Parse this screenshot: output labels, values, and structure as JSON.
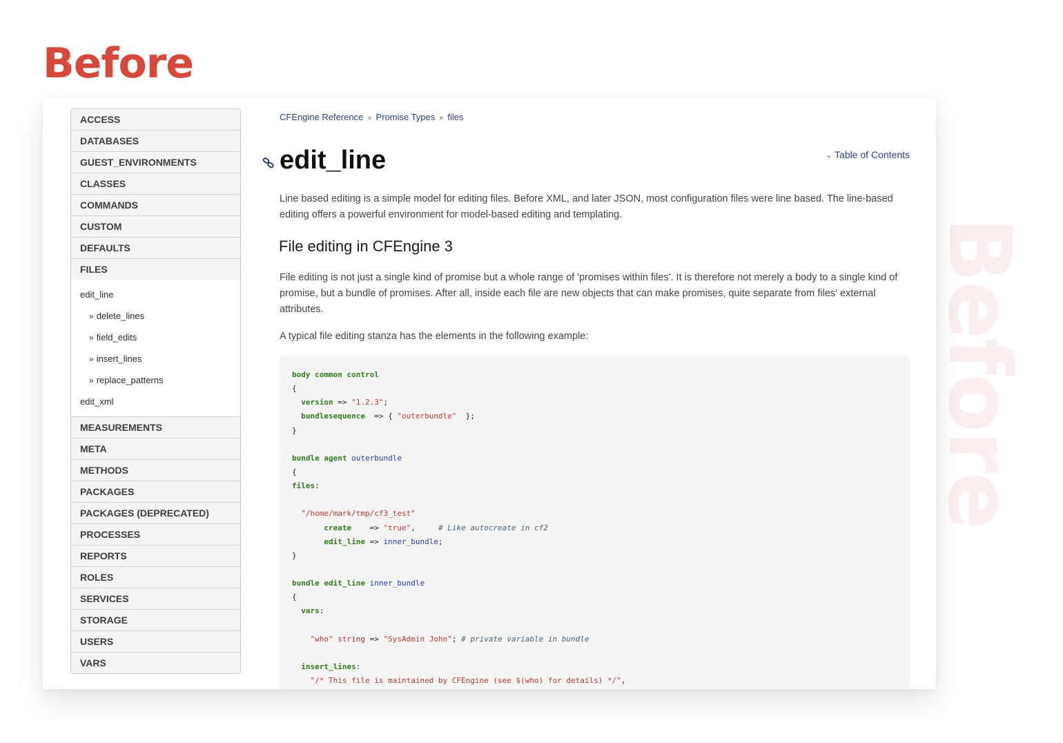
{
  "labels": {
    "heading": "Before",
    "watermark": "Before"
  },
  "sidebar": {
    "items_top": [
      "ACCESS",
      "DATABASES",
      "GUEST_ENVIRONMENTS",
      "CLASSES",
      "COMMANDS",
      "CUSTOM",
      "DEFAULTS",
      "FILES"
    ],
    "files_sub": {
      "edit_line": "edit_line",
      "edit_line_children": [
        "delete_lines",
        "field_edits",
        "insert_lines",
        "replace_patterns"
      ],
      "edit_xml": "edit_xml",
      "chevron": "»"
    },
    "items_bottom": [
      "MEASUREMENTS",
      "META",
      "METHODS",
      "PACKAGES",
      "PACKAGES (DEPRECATED)",
      "PROCESSES",
      "REPORTS",
      "ROLES",
      "SERVICES",
      "STORAGE",
      "USERS",
      "VARS"
    ]
  },
  "breadcrumb": {
    "items": [
      "CFEngine Reference",
      "Promise Types",
      "files"
    ],
    "separator": "»"
  },
  "page": {
    "title": "edit_line",
    "toc_label": "Table of Contents",
    "toc_caret": "⌄",
    "intro": "Line based editing is a simple model for editing files. Before XML, and later JSON, most configuration files were line based. The line-based editing offers a powerful environment for model-based editing and templating.",
    "section_heading": "File editing in CFEngine 3",
    "section_p1": "File editing is not just a single kind of promise but a whole range of 'promises within files'. It is therefore not merely a body to a single kind of promise, but a bundle of promises. After all, inside each file are new objects that can make promises, quite separate from files' external attributes.",
    "section_p2": "A typical file editing stanza has the elements in the following example:"
  },
  "code": {
    "lines": [
      [
        [
          "kw",
          "body common control"
        ]
      ],
      [
        [
          "punct",
          "{"
        ]
      ],
      [
        [
          "punct",
          "  "
        ],
        [
          "kw",
          "version"
        ],
        [
          "punct",
          " => "
        ],
        [
          "str",
          "\"1.2.3\""
        ],
        [
          "punct",
          ";"
        ]
      ],
      [
        [
          "punct",
          "  "
        ],
        [
          "kw",
          "bundlesequence"
        ],
        [
          "punct",
          "  => { "
        ],
        [
          "str",
          "\"outerbundle\""
        ],
        [
          "punct",
          "  };"
        ]
      ],
      [
        [
          "punct",
          "}"
        ]
      ],
      [],
      [
        [
          "kw",
          "bundle agent "
        ],
        [
          "ident",
          "outerbundle"
        ]
      ],
      [
        [
          "punct",
          "{"
        ]
      ],
      [
        [
          "kw",
          "files"
        ],
        [
          "punct",
          ":"
        ]
      ],
      [],
      [
        [
          "punct",
          "  "
        ],
        [
          "str",
          "\"/home/mark/tmp/cf3_test\""
        ]
      ],
      [
        [
          "punct",
          "       "
        ],
        [
          "kw",
          "create"
        ],
        [
          "punct",
          "    => "
        ],
        [
          "str",
          "\"true\""
        ],
        [
          "punct",
          ",     "
        ],
        [
          "cmt",
          "# Like autocreate in cf2"
        ]
      ],
      [
        [
          "punct",
          "       "
        ],
        [
          "kw",
          "edit_line"
        ],
        [
          "punct",
          " => "
        ],
        [
          "ident",
          "inner_bundle"
        ],
        [
          "punct",
          ";"
        ]
      ],
      [
        [
          "punct",
          "}"
        ]
      ],
      [],
      [
        [
          "kw",
          "bundle edit_line "
        ],
        [
          "ident",
          "inner_bundle"
        ]
      ],
      [
        [
          "punct",
          "{"
        ]
      ],
      [
        [
          "punct",
          "  "
        ],
        [
          "kw",
          "vars"
        ],
        [
          "punct",
          ":"
        ]
      ],
      [],
      [
        [
          "punct",
          "    "
        ],
        [
          "str",
          "\"who\""
        ],
        [
          "punct",
          " "
        ],
        [
          "type",
          "string"
        ],
        [
          "punct",
          " => "
        ],
        [
          "str",
          "\"SysAdmin John\""
        ],
        [
          "punct",
          "; "
        ],
        [
          "cmt",
          "# private variable in bundle"
        ]
      ],
      [],
      [
        [
          "punct",
          "  "
        ],
        [
          "kw",
          "insert_lines"
        ],
        [
          "punct",
          ":"
        ]
      ],
      [
        [
          "punct",
          "    "
        ],
        [
          "str",
          "\"/* This file is maintained by CFEngine (see $(who) for details) */\""
        ],
        [
          "punct",
          ","
        ]
      ]
    ]
  },
  "colors": {
    "heading_red": "#d9473a",
    "link_blue": "#2b3f8f",
    "code_keyword": "#2e7d1a",
    "code_string": "#c0392b",
    "code_ident": "#1d3bbf",
    "code_comment": "#45647a"
  },
  "icons": {
    "anchor": "link-icon",
    "toc": "chevron-down-icon"
  }
}
